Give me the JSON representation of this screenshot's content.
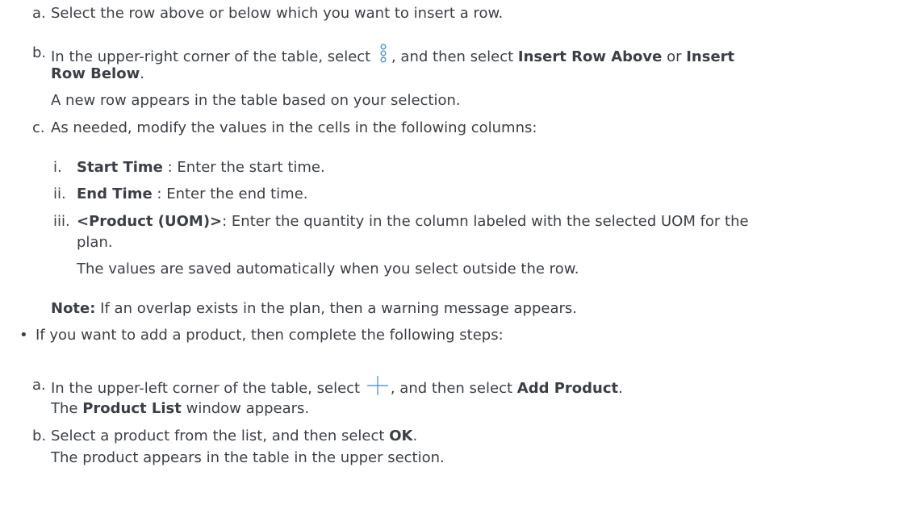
{
  "steps_a": [
    {
      "marker": "a.",
      "text": "Select the row above or below which you want to insert a row."
    },
    {
      "marker": "b.",
      "pre": "In the upper-right corner of the table, select",
      "icon": "more-vertical-icon",
      "mid": ", and then select",
      "opt1": "Insert Row Above",
      "or": "or",
      "opt2_part1": "Insert",
      "opt2_part2": "Row Below",
      "period": ".",
      "result": "A new row appears in the table based on your selection."
    },
    {
      "marker": "c.",
      "text": "As needed, modify the values in the cells in the following columns:"
    }
  ],
  "substeps": [
    {
      "marker": "i.",
      "label": "Start Time",
      "text": " : Enter the start time."
    },
    {
      "marker": "ii.",
      "label": "End Time",
      "text": " : Enter the end time."
    },
    {
      "marker": "iii.",
      "label": "<Product (UOM)>",
      "text": ": Enter the quantity in the column labeled with the selected UOM for the",
      "text_cont": "plan.",
      "result": "The values are saved automatically when you select outside the row."
    }
  ],
  "note": {
    "label": "Note:",
    "text": " If an overlap exists in the plan, then a warning message appears."
  },
  "bullet": {
    "marker": "•",
    "text": "If you want to add a product, then complete the following steps:"
  },
  "steps_b": [
    {
      "marker": "a.",
      "pre": "In the upper-left corner of the table, select",
      "icon": "plus-icon",
      "mid": ", and then select",
      "opt": "Add Product",
      "period": ".",
      "result_pre": "The",
      "result_bold": "Product List",
      "result_post": "window appears."
    },
    {
      "marker": "b.",
      "pre": "Select a product from the list, and then select",
      "opt": "OK",
      "period": ".",
      "result": "The product appears in the table in the upper section."
    }
  ],
  "colors": {
    "text": "#3b3f45",
    "icon": "#5a9bd8"
  }
}
